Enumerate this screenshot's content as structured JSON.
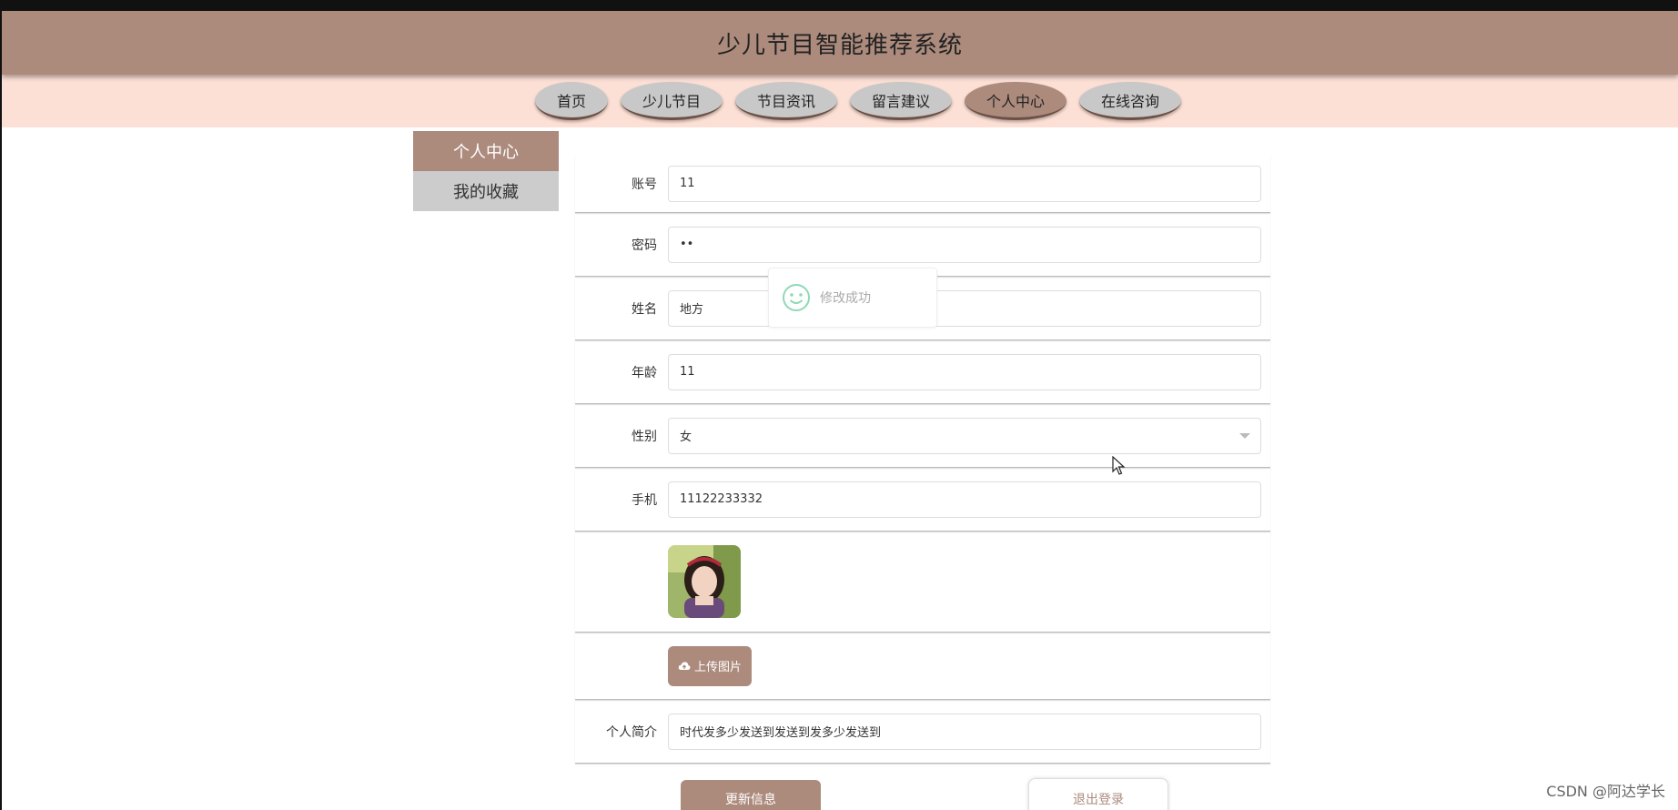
{
  "header": {
    "title": "少儿节目智能推荐系统"
  },
  "nav": {
    "items": [
      {
        "label": "首页"
      },
      {
        "label": "少儿节目"
      },
      {
        "label": "节目资讯"
      },
      {
        "label": "留言建议"
      },
      {
        "label": "个人中心",
        "active": true
      },
      {
        "label": "在线咨询"
      }
    ]
  },
  "sidebar": {
    "items": [
      {
        "label": "个人中心",
        "active": true
      },
      {
        "label": "我的收藏"
      }
    ]
  },
  "form": {
    "account": {
      "label": "账号",
      "value": "11"
    },
    "password": {
      "label": "密码",
      "value": "••"
    },
    "name": {
      "label": "姓名",
      "value": "地方"
    },
    "age": {
      "label": "年龄",
      "value": "11"
    },
    "gender": {
      "label": "性别",
      "value": "女"
    },
    "phone": {
      "label": "手机",
      "value": "11122233332"
    },
    "upload_label": "上传图片",
    "bio": {
      "label": "个人简介",
      "value": "时代发多少发送到发送到发多少发送到"
    }
  },
  "buttons": {
    "update": "更新信息",
    "logout": "退出登录"
  },
  "toast": {
    "message": "修改成功"
  },
  "watermark": "CSDN @阿达学长",
  "colors": {
    "accent": "#ac8b7d",
    "nav_bg": "#fde0d5",
    "nav_item": "#c8c8c8"
  }
}
